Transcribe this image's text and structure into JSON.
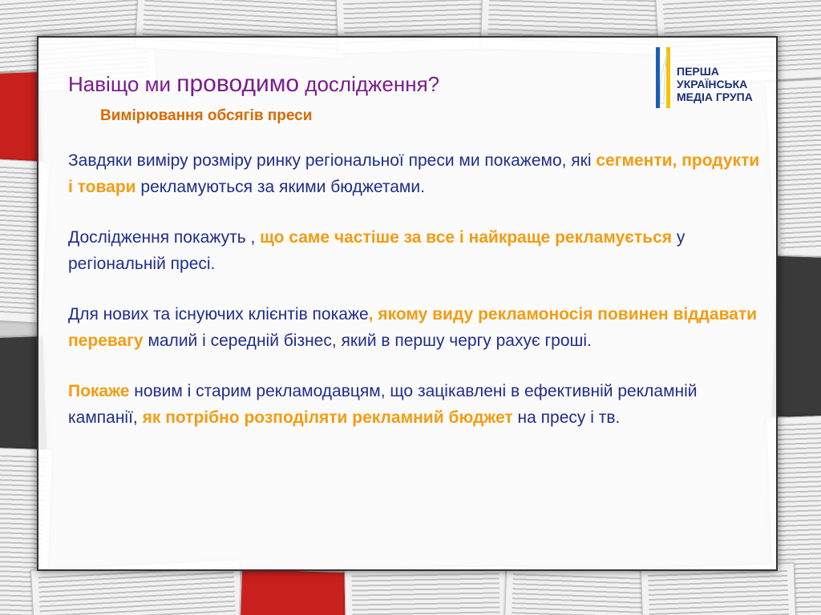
{
  "slide": {
    "title_part1": "Навіщо ми ",
    "title_part2": "проводимо",
    "title_part3": " дослідження?",
    "subtitle": "Вимірювання обсягів преси"
  },
  "logo": {
    "line1": "ПЕРША",
    "line2": "УКРАЇНСЬКА",
    "line3": "МЕДІА ГРУПА"
  },
  "paragraphs": {
    "p1": {
      "t1": "Завдяки виміру розміру ринку регіональної преси ми покажемо, які ",
      "h1": "сегменти, продукти і товари",
      "t2": " рекламуються за якими бюджетами."
    },
    "p2": {
      "t1": "Дослідження покажуть , ",
      "h1": "що  саме частіше за все і найкраще рекламується",
      "t2": " у регіональній пресі."
    },
    "p3": {
      "t1": "Для нових та існуючих клієнтів покаже",
      "h1": ", якому виду рекламоносія повинен віддавати перевагу",
      "t2": "  малий і середній бізнес, який в першу чергу рахує гроші."
    },
    "p4": {
      "h1": "Покаже",
      "t1": " новим і старим рекламодавцям, що зацікавлені в ефективній рекламній кампанії, ",
      "h2": "як потрібно розподіляти рекламний бюджет",
      "t2": " на пресу і тв."
    }
  },
  "colors": {
    "title": "#7a1c8c",
    "subtitle": "#d96a00",
    "body": "#1f2d8c",
    "highlight": "#f39c12",
    "logo_text": "#1b2f7a"
  }
}
